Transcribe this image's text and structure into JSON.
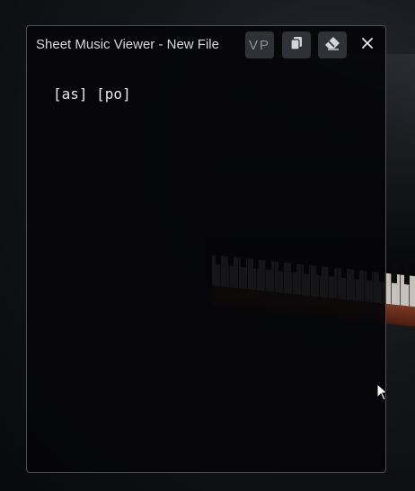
{
  "window": {
    "title": "Sheet Music Viewer - New File",
    "buttons": {
      "vp_label": "VP",
      "copy_icon": "copy-icon",
      "erase_icon": "eraser-icon",
      "close_icon": "close-icon"
    },
    "content_text": "[as] [po]"
  },
  "colors": {
    "window_bg": "#050508",
    "window_border": "#4b4f57",
    "button_bg": "#2f3136",
    "text": "#e8eaee"
  }
}
